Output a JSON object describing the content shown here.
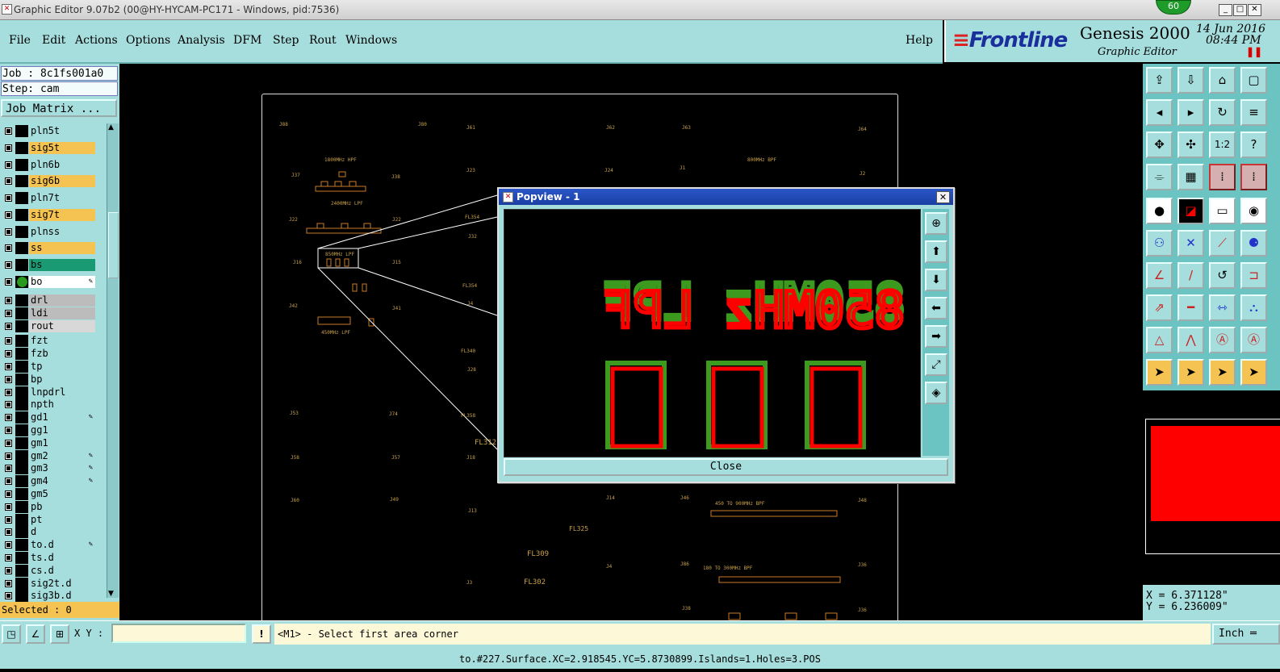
{
  "window": {
    "title": "Graphic Editor 9.07b2 (00@HY-HYCAM-PC171 - Windows, pid:7536)",
    "counter": "60"
  },
  "menu": [
    "File",
    "Edit",
    "Actions",
    "Options",
    "Analysis",
    "DFM",
    "Step",
    "Rout",
    "Windows"
  ],
  "help": "Help",
  "brand": {
    "logo": "Frontline",
    "product": "Genesis 2000",
    "subtitle": "Graphic Editor",
    "date": "14 Jun 2016",
    "time": "08:44 PM"
  },
  "job": {
    "job_label": "Job : 8c1fs001a0",
    "step_label": "Step: cam",
    "matrix_button": "Job Matrix ..."
  },
  "layers": [
    {
      "name": "pln5t",
      "color": "#a6dedd"
    },
    {
      "name": "sig5t",
      "color": "#f5c351"
    },
    {
      "name": "pln6b",
      "color": "#a6dedd"
    },
    {
      "name": "sig6b",
      "color": "#f5c351"
    },
    {
      "name": "pln7t",
      "color": "#a6dedd"
    },
    {
      "name": "sig7t",
      "color": "#f5c351"
    },
    {
      "name": "plnss",
      "color": "#a6dedd"
    },
    {
      "name": "ss",
      "color": "#f5c351"
    },
    {
      "name": "bs",
      "color": "#1a9a72"
    },
    {
      "name": "bo",
      "color": "#ffffff",
      "active": true
    },
    {
      "name": "drl",
      "color": "#bcbcbc"
    },
    {
      "name": "ldi",
      "color": "#bcbcbc"
    },
    {
      "name": "rout",
      "color": "#d8d8d8"
    },
    {
      "name": "fzt",
      "color": "#a6dedd"
    },
    {
      "name": "fzb",
      "color": "#a6dedd"
    },
    {
      "name": "tp",
      "color": "#a6dedd"
    },
    {
      "name": "bp",
      "color": "#a6dedd"
    },
    {
      "name": "lnpdrl",
      "color": "#a6dedd"
    },
    {
      "name": "npth",
      "color": "#a6dedd"
    },
    {
      "name": "gd1",
      "color": "#a6dedd",
      "edit": true
    },
    {
      "name": "gg1",
      "color": "#a6dedd"
    },
    {
      "name": "gm1",
      "color": "#a6dedd"
    },
    {
      "name": "gm2",
      "color": "#a6dedd",
      "edit": true
    },
    {
      "name": "gm3",
      "color": "#a6dedd",
      "edit": true
    },
    {
      "name": "gm4",
      "color": "#a6dedd",
      "edit": true
    },
    {
      "name": "gm5",
      "color": "#a6dedd"
    },
    {
      "name": "pb",
      "color": "#a6dedd"
    },
    {
      "name": "pt",
      "color": "#a6dedd"
    },
    {
      "name": "d",
      "color": "#a6dedd"
    },
    {
      "name": "to.d",
      "color": "#a6dedd",
      "edit": true
    },
    {
      "name": "ts.d",
      "color": "#a6dedd"
    },
    {
      "name": "cs.d",
      "color": "#a6dedd"
    },
    {
      "name": "sig2t.d",
      "color": "#a6dedd"
    },
    {
      "name": "sig3b.d",
      "color": "#a6dedd"
    }
  ],
  "selected": "Selected : 0",
  "board_labels": [
    "FL309",
    "FL302",
    "FL312",
    "FL325"
  ],
  "popview": {
    "title": "Popview - 1",
    "close": "Close",
    "text_top": "850MHz LPF"
  },
  "coords": {
    "x": "X = 6.371128\"",
    "y": "Y = 6.236009\""
  },
  "bottom": {
    "xy_label": "X Y :",
    "xy_value": "",
    "prompt": "<M1> - Select first area corner",
    "unit": "Inch",
    "status": "to.#227.Surface.XC=2.918545.YC=5.8730899.Islands=1.Holes=3.POS"
  }
}
